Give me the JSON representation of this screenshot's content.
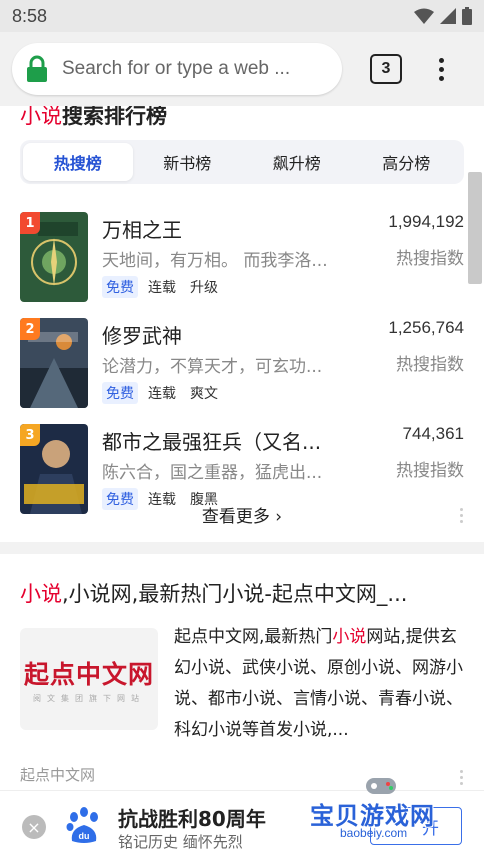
{
  "status_bar": {
    "time": "8:58"
  },
  "browser": {
    "search_placeholder": "Search for or type a web ...",
    "tab_count": "3"
  },
  "rank_card": {
    "title_highlight": "小说",
    "title_rest": "搜索排行榜",
    "tabs": [
      "热搜榜",
      "新书榜",
      "飙升榜",
      "高分榜"
    ],
    "active_tab": 0,
    "books": [
      {
        "rank": "1",
        "name": "万相之王",
        "desc": "天地间，有万相。 而我李洛...",
        "tags": [
          "免费",
          "连载",
          "升级"
        ],
        "count": "1,994,192",
        "count_label": "热搜指数",
        "badge_color": "#f24a30"
      },
      {
        "rank": "2",
        "name": "修罗武神",
        "desc": "论潜力，不算天才，可玄功...",
        "tags": [
          "免费",
          "连载",
          "爽文"
        ],
        "count": "1,256,764",
        "count_label": "热搜指数",
        "badge_color": "#ff7a1f"
      },
      {
        "rank": "3",
        "name": "都市之最强狂兵（又名...",
        "desc": "陈六合，国之重器，猛虎出...",
        "tags": [
          "免费",
          "连载",
          "腹黑"
        ],
        "count": "744,361",
        "count_label": "热搜指数",
        "badge_color": "#f5a623"
      }
    ],
    "more_label": "查看更多"
  },
  "result_card": {
    "title_highlight": "小说",
    "title_rest": ",小说网,最新热门小说-起点中文网_...",
    "thumb_logo": "起点中文网",
    "thumb_sub": "阅文集团旗下网站",
    "snippet_pre": "起点中文网,最新热门",
    "snippet_hl": "小说",
    "snippet_post": "网站,提供玄幻小说、武侠小说、原创小说、网游小说、都市小说、言情小说、青春小说、科幻小说等首发小说,...",
    "source": "起点中文网"
  },
  "banner": {
    "title": "抗战胜利80周年",
    "subtitle": "铭记历史 缅怀先烈",
    "button_label": "开"
  },
  "watermark": {
    "text": "宝贝游戏网",
    "url": "baobeiy.com"
  }
}
